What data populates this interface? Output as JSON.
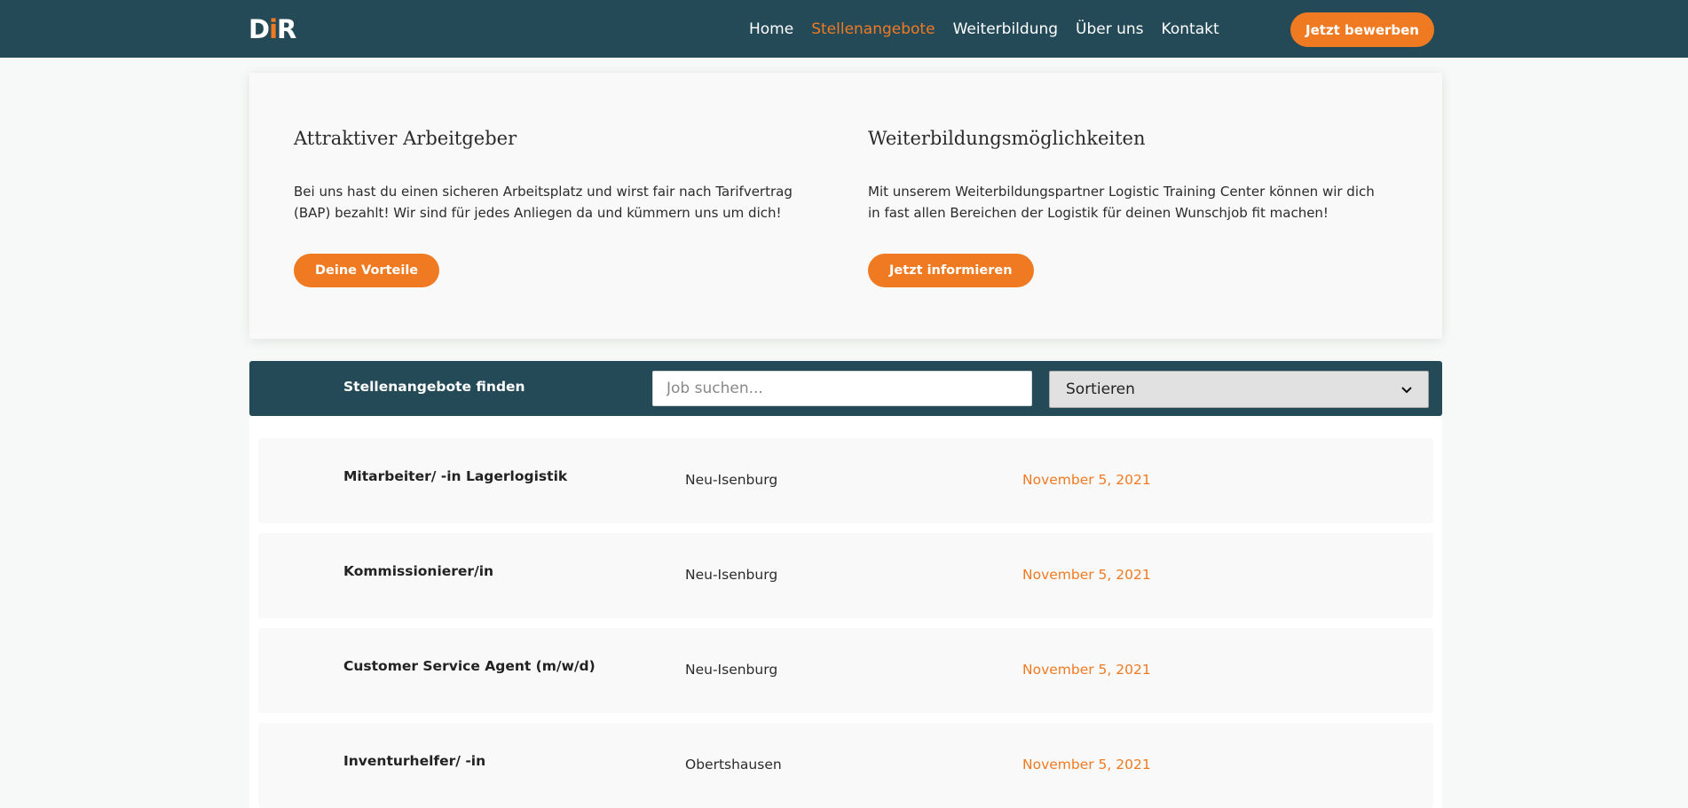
{
  "header": {
    "logo_text": "DiR",
    "nav": [
      {
        "label": "Home",
        "active": false
      },
      {
        "label": "Stellenangebote",
        "active": true
      },
      {
        "label": "Weiterbildung",
        "active": false
      },
      {
        "label": "Über uns",
        "active": false
      },
      {
        "label": "Kontakt",
        "active": false
      }
    ],
    "cta_label": "Jetzt bewerben"
  },
  "features": [
    {
      "title": "Attraktiver Arbeitgeber",
      "text": "Bei uns hast du einen sicheren Arbeitsplatz und wirst fair nach Tarifvertrag (BAP) bezahlt! Wir sind für jedes Anliegen da und kümmern uns um dich!",
      "button": "Deine Vorteile"
    },
    {
      "title": "Weiterbildungsmöglichkeiten",
      "text": "Mit unserem Weiterbildungspartner Logistic Training Center können wir dich in fast allen Bereichen der Logistik für deinen Wunschjob fit machen!",
      "button": "Jetzt informieren"
    }
  ],
  "search": {
    "label": "Stellenangebote finden",
    "placeholder": "Job suchen...",
    "sort_selected": "Sortieren"
  },
  "jobs": [
    {
      "title": "Mitarbeiter/ -in Lagerlogistik",
      "location": "Neu-Isenburg",
      "date": "November 5, 2021"
    },
    {
      "title": "Kommissionierer/in",
      "location": "Neu-Isenburg",
      "date": "November 5, 2021"
    },
    {
      "title": "Customer Service Agent (m/w/d)",
      "location": "Neu-Isenburg",
      "date": "November 5, 2021"
    },
    {
      "title": "Inventurhelfer/ -in",
      "location": "Obertshausen",
      "date": "November 5, 2021"
    }
  ],
  "colors": {
    "header_bg": "#244a58",
    "accent": "#f07a22"
  }
}
